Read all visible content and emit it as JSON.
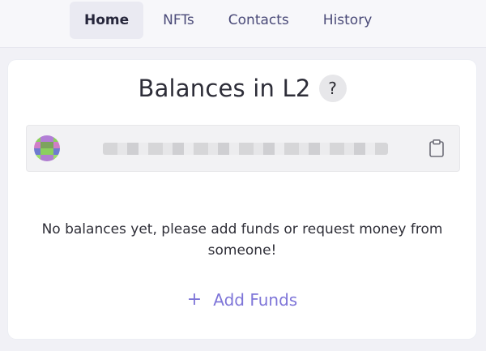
{
  "nav": {
    "tabs": [
      {
        "label": "Home",
        "active": true
      },
      {
        "label": "NFTs",
        "active": false
      },
      {
        "label": "Contacts",
        "active": false
      },
      {
        "label": "History",
        "active": false
      }
    ]
  },
  "balances": {
    "title": "Balances in L2",
    "help_label": "?",
    "empty_message": "No balances yet, please add funds or request money from someone!",
    "add_funds_icon": "+",
    "add_funds_label": "Add Funds"
  },
  "colors": {
    "accent": "#7e75d8",
    "page_bg": "#f1f1f6",
    "card_bg": "#ffffff"
  },
  "icons": {
    "help": "question-icon",
    "copy": "clipboard-icon",
    "add": "plus-icon"
  }
}
